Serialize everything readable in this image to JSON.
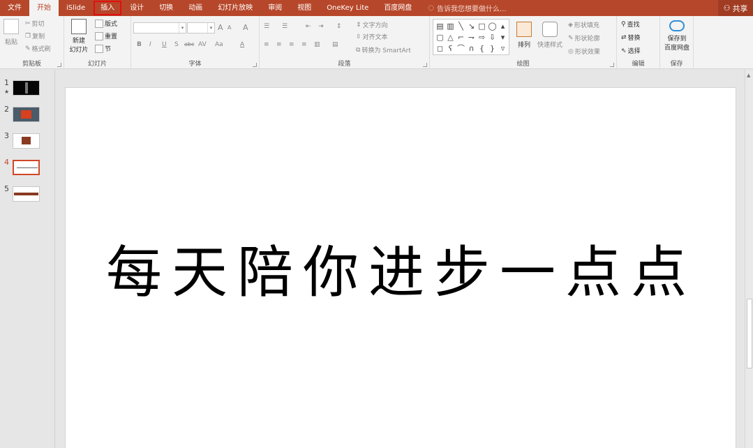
{
  "tabs": [
    "文件",
    "开始",
    "iSlide",
    "插入",
    "设计",
    "切换",
    "动画",
    "幻灯片放映",
    "审阅",
    "视图",
    "OneKey Lite",
    "百度网盘"
  ],
  "tell_me": "告诉我您想要做什么...",
  "share": "共享",
  "ribbon": {
    "clipboard": {
      "paste": "粘贴",
      "cut": "剪切",
      "copy": "复制",
      "format_painter": "格式刷",
      "label": "剪贴板"
    },
    "slides": {
      "new_line1": "新建",
      "new_line2": "幻灯片",
      "layout": "版式",
      "reset": "重置",
      "section": "节",
      "label": "幻灯片"
    },
    "font": {
      "bold": "B",
      "italic": "I",
      "underline": "U",
      "shadow": "S",
      "strike": "abc",
      "spacing": "AV",
      "case": "Aa",
      "color": "A",
      "grow": "A",
      "shrink": "A",
      "clear": "A",
      "label": "字体"
    },
    "paragraph": {
      "text_direction": "文字方向",
      "align_text": "对齐文本",
      "smartart": "转换为 SmartArt",
      "label": "段落"
    },
    "drawing": {
      "arrange": "排列",
      "quick_styles": "快速样式",
      "fill": "形状填充",
      "outline": "形状轮廓",
      "effects": "形状效果",
      "label": "绘图"
    },
    "editing": {
      "find": "查找",
      "replace": "替换",
      "select": "选择",
      "label": "编辑"
    },
    "save": {
      "line1": "保存到",
      "line2": "百度网盘",
      "label": "保存"
    }
  },
  "slides": [
    {
      "num": "1",
      "star": "★"
    },
    {
      "num": "2"
    },
    {
      "num": "3"
    },
    {
      "num": "4"
    },
    {
      "num": "5"
    }
  ],
  "slide_text": "每天陪你进步一点点",
  "colors": {
    "accent": "#b7472a",
    "selected_thumb": "#d24726",
    "highlight_box": "#e01010"
  }
}
